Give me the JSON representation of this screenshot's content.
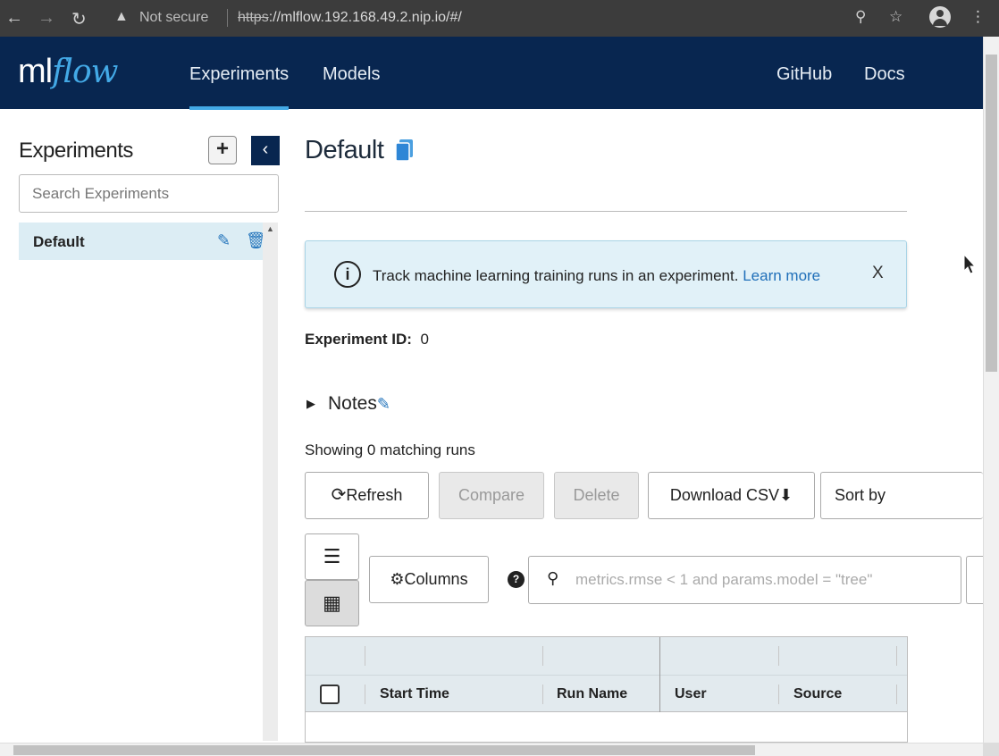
{
  "browser": {
    "security_label": "Not secure",
    "url_scheme": "https",
    "url_rest": "://mlflow.192.168.49.2.nip.io/#/"
  },
  "header": {
    "logo_ml": "ml",
    "logo_flow": "flow",
    "nav_left": [
      "Experiments",
      "Models"
    ],
    "nav_right": [
      "GitHub",
      "Docs"
    ],
    "accent_color": "#43a9e6",
    "brand_color": "#082650"
  },
  "sidebar": {
    "title": "Experiments",
    "add_label": "+",
    "search_placeholder": "Search Experiments",
    "experiments": [
      {
        "name": "Default"
      }
    ]
  },
  "main": {
    "title": "Default",
    "alert": {
      "message": "Track machine learning training runs in an experiment.",
      "link": "Learn more",
      "close": "X"
    },
    "experiment_id_label": "Experiment ID:",
    "experiment_id": "0",
    "notes_label": "Notes",
    "showing_text": "Showing 0 matching runs",
    "buttons": {
      "refresh": "Refresh",
      "compare": "Compare",
      "delete": "Delete",
      "download_csv": "Download CSV",
      "sort_by": "Sort by",
      "columns": "Columns"
    },
    "run_search_placeholder": "metrics.rmse < 1 and params.model = \"tree\"",
    "table": {
      "columns": [
        "Start Time",
        "Run Name",
        "User",
        "Source"
      ]
    }
  }
}
